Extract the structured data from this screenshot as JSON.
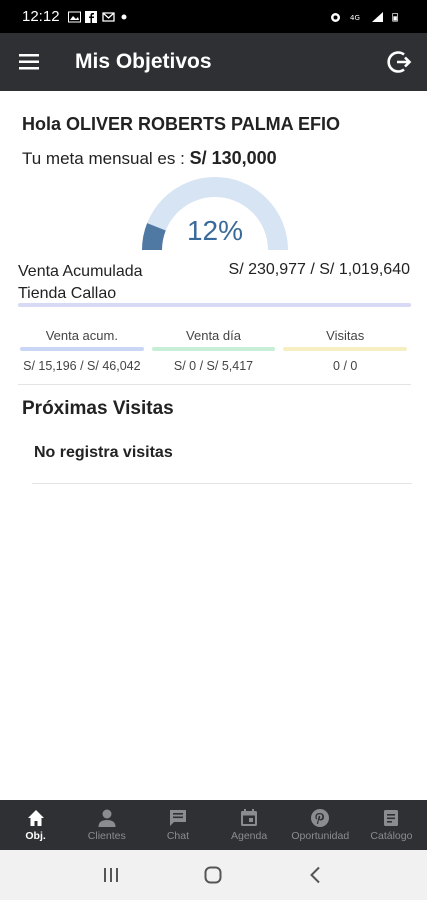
{
  "status": {
    "time": "12:12"
  },
  "appbar": {
    "title": "Mis Objetivos"
  },
  "greeting": "Hola OLIVER ROBERTS PALMA EFIO",
  "meta": {
    "label": "Tu meta mensual es :",
    "amount": "S/ 130,000"
  },
  "gauge": {
    "percent_text": "12%",
    "fraction": 0.12,
    "track_color": "#d6e4f3",
    "fill_color": "#4f79a3"
  },
  "venta": {
    "label_line1": "Venta Acumulada",
    "label_line2": "Tienda Callao",
    "value": "S/ 230,977 / S/ 1,019,640"
  },
  "metrics": [
    {
      "label": "Venta acum.",
      "value": "S/ 15,196 / S/ 46,042",
      "color": "#c9d6f5"
    },
    {
      "label": "Venta día",
      "value": "S/ 0 / S/ 5,417",
      "color": "#c7eed6"
    },
    {
      "label": "Visitas",
      "value": "0 / 0",
      "color": "#f5efc2"
    }
  ],
  "visits": {
    "title": "Próximas Visitas",
    "empty": "No registra visitas"
  },
  "tabs": [
    {
      "label": "Obj.",
      "icon": "home-icon",
      "active": true
    },
    {
      "label": "Clientes",
      "icon": "person-icon",
      "active": false
    },
    {
      "label": "Chat",
      "icon": "chat-icon",
      "active": false
    },
    {
      "label": "Agenda",
      "icon": "calendar-icon",
      "active": false
    },
    {
      "label": "Oportunidad",
      "icon": "pinterest-icon",
      "active": false
    },
    {
      "label": "Catálogo",
      "icon": "catalog-icon",
      "active": false
    }
  ]
}
